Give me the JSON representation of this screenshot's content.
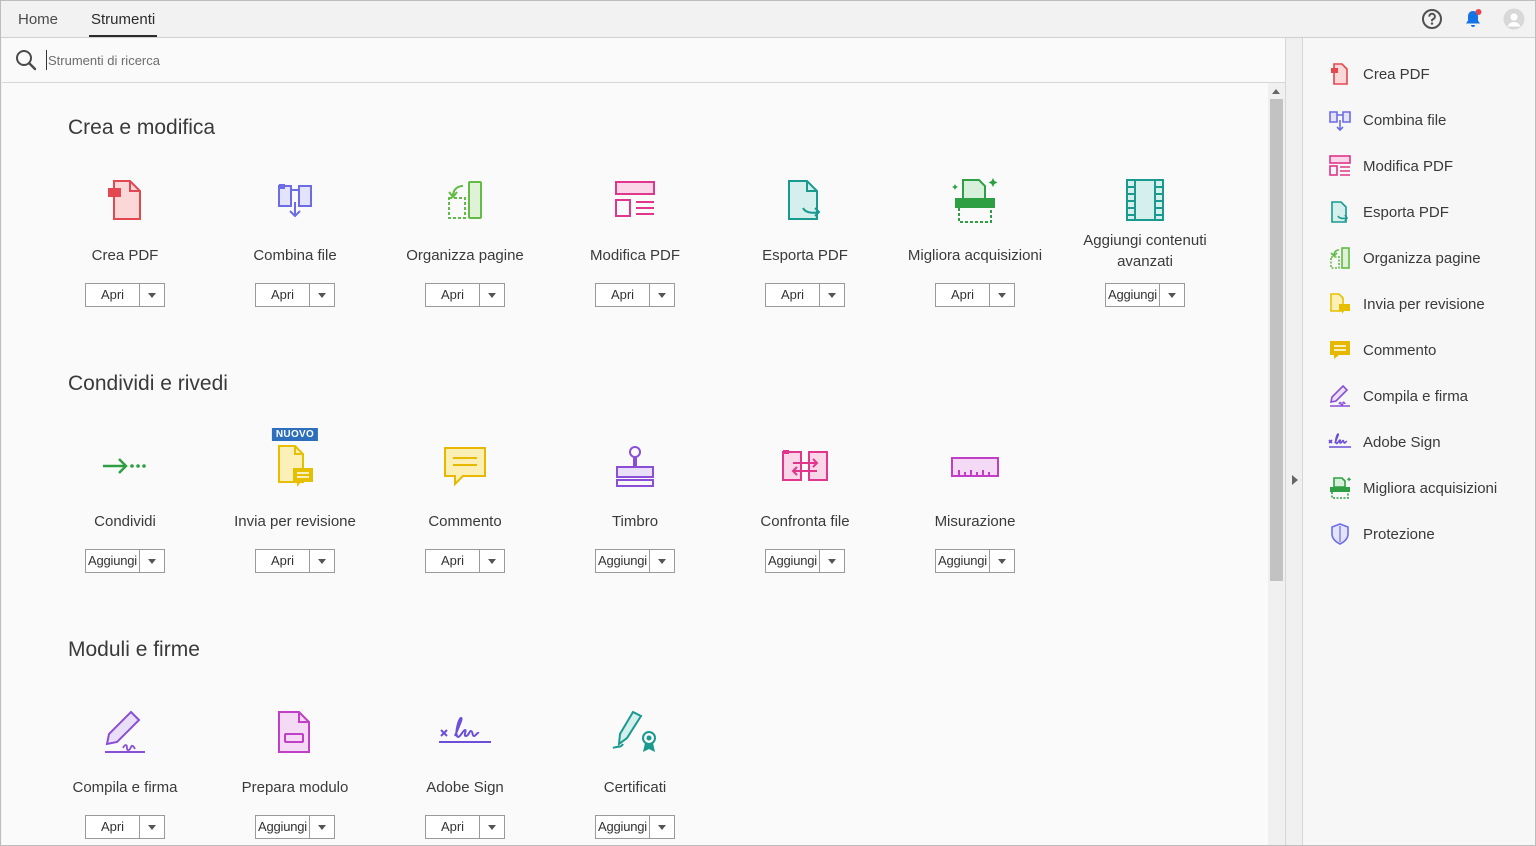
{
  "topbar": {
    "tabs": [
      {
        "label": "Home"
      },
      {
        "label": "Strumenti"
      }
    ],
    "icons": [
      "help-icon",
      "notification-bell-icon",
      "account-avatar-icon"
    ]
  },
  "search": {
    "placeholder": "Strumenti di ricerca"
  },
  "sections": [
    {
      "title": "Crea e modifica",
      "tools": [
        {
          "label": "Crea PDF",
          "button": "Apri",
          "icon": "create-pdf-icon",
          "color": "#e34850"
        },
        {
          "label": "Combina file",
          "button": "Apri",
          "icon": "combine-files-icon",
          "color": "#6c6ce6"
        },
        {
          "label": "Organizza pagine",
          "button": "Apri",
          "icon": "organize-pages-icon",
          "color": "#62bb46"
        },
        {
          "label": "Modifica PDF",
          "button": "Apri",
          "icon": "edit-pdf-icon",
          "color": "#e0368b"
        },
        {
          "label": "Esporta PDF",
          "button": "Apri",
          "icon": "export-pdf-icon",
          "color": "#1a9a8f"
        },
        {
          "label": "Migliora acquisizioni",
          "button": "Apri",
          "icon": "enhance-scans-icon",
          "color": "#2ea043"
        },
        {
          "label": "Aggiungi contenuti avanzati",
          "button": "Aggiungi",
          "icon": "rich-media-icon",
          "color": "#1a9a8f"
        }
      ]
    },
    {
      "title": "Condividi e rivedi",
      "tools": [
        {
          "label": "Condividi",
          "button": "Aggiungi",
          "icon": "share-icon",
          "color": "#2ea043"
        },
        {
          "label": "Invia per revisione",
          "button": "Apri",
          "icon": "send-for-review-icon",
          "color": "#e6c000",
          "badge": "NUOVO"
        },
        {
          "label": "Commento",
          "button": "Apri",
          "icon": "comment-icon",
          "color": "#e6b800"
        },
        {
          "label": "Timbro",
          "button": "Aggiungi",
          "icon": "stamp-icon",
          "color": "#8a4fd6"
        },
        {
          "label": "Confronta file",
          "button": "Aggiungi",
          "icon": "compare-files-icon",
          "color": "#e0368b"
        },
        {
          "label": "Misurazione",
          "button": "Aggiungi",
          "icon": "measure-icon",
          "color": "#c13ec6"
        }
      ]
    },
    {
      "title": "Moduli e firme",
      "tools": [
        {
          "label": "Compila e firma",
          "button": "Apri",
          "icon": "fill-sign-icon",
          "color": "#8a4fd6"
        },
        {
          "label": "Prepara modulo",
          "button": "Aggiungi",
          "icon": "prepare-form-icon",
          "color": "#c13ec6"
        },
        {
          "label": "Adobe Sign",
          "button": "Apri",
          "icon": "adobe-sign-icon",
          "color": "#6c4fd6"
        },
        {
          "label": "Certificati",
          "button": "Aggiungi",
          "icon": "certificates-icon",
          "color": "#1a9a8f"
        }
      ]
    }
  ],
  "right_pane": {
    "items": [
      {
        "label": "Crea PDF",
        "icon": "create-pdf-icon",
        "color": "#e34850"
      },
      {
        "label": "Combina file",
        "icon": "combine-files-icon",
        "color": "#6c6ce6"
      },
      {
        "label": "Modifica PDF",
        "icon": "edit-pdf-icon",
        "color": "#e0368b"
      },
      {
        "label": "Esporta PDF",
        "icon": "export-pdf-icon",
        "color": "#1a9a8f"
      },
      {
        "label": "Organizza pagine",
        "icon": "organize-pages-icon",
        "color": "#62bb46"
      },
      {
        "label": "Invia per revisione",
        "icon": "send-for-review-icon",
        "color": "#e6c000"
      },
      {
        "label": "Commento",
        "icon": "comment-icon",
        "color": "#e6b800"
      },
      {
        "label": "Compila e firma",
        "icon": "fill-sign-icon",
        "color": "#8a4fd6"
      },
      {
        "label": "Adobe Sign",
        "icon": "adobe-sign-icon",
        "color": "#6c4fd6"
      },
      {
        "label": "Migliora acquisizioni",
        "icon": "enhance-scans-icon",
        "color": "#2ea043"
      },
      {
        "label": "Protezione",
        "icon": "protect-shield-icon",
        "color": "#6c6ce6"
      }
    ]
  }
}
